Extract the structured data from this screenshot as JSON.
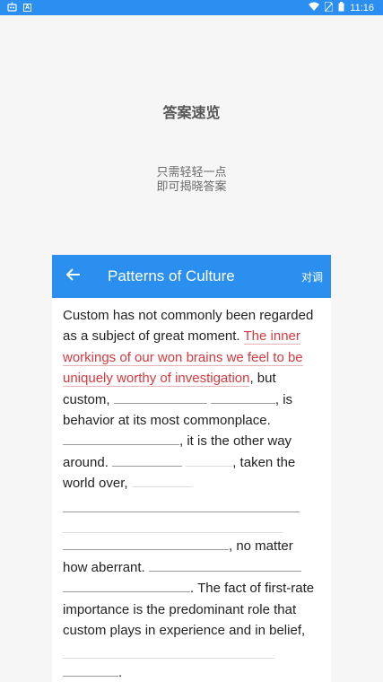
{
  "status_bar": {
    "left_icon_1": "robot-notification-icon",
    "left_icon_2": "a-badge-icon",
    "wifi_icon": "wifi-icon",
    "sim_icon": "sim-card-icon",
    "battery_icon": "battery-icon",
    "time": "11:16"
  },
  "intro": {
    "title": "答案速览",
    "line1": "只需轻轻一点",
    "line2": "即可揭晓答案"
  },
  "card": {
    "title": "Patterns of Culture",
    "action": "对调",
    "back_icon": "arrow-left-icon"
  },
  "passage": {
    "s1": "Custom has not commonly been regarded as a subject of great moment.",
    "highlight": "The inner workings of our won brains we feel to be uniquely worthy of investigation",
    "s2": ", but custom,",
    "s3": ", is behavior at its most commonplace.",
    "s4": ", it is the other way around.",
    "s5": ", taken the world over,",
    "s6": ", no matter how aberrant.",
    "s7": ". The fact of first-rate importance is the predominant role that custom plays in experience and in belief,",
    "s8": "."
  },
  "colors": {
    "primary": "#2b8ff0",
    "highlight": "#d8393f",
    "background": "#f6f6f6"
  }
}
